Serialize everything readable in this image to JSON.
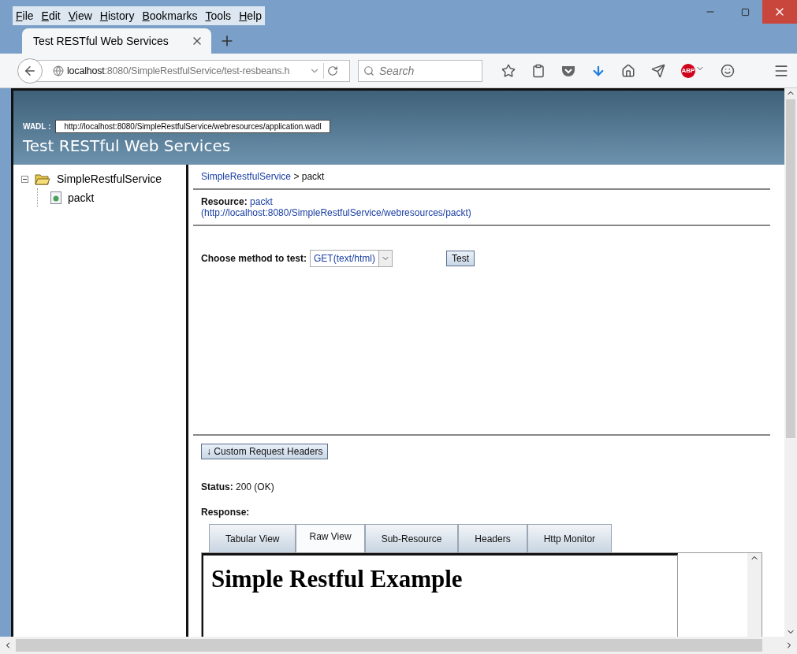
{
  "menu": [
    "File",
    "Edit",
    "View",
    "History",
    "Bookmarks",
    "Tools",
    "Help"
  ],
  "browser_tabs": [
    {
      "title": "Test RESTful Web Services",
      "selected": true
    }
  ],
  "address": {
    "host": "localhost",
    "path": ":8080/SimpleRestfulService/test-resbeans.h"
  },
  "search": {
    "placeholder": "Search"
  },
  "adblock_badge": "ABP",
  "header": {
    "wadl_label": "WADL :",
    "wadl_url": "http://localhost:8080/SimpleRestfulService/webresources/application.wadl",
    "title": "Test RESTful Web Services"
  },
  "tree": [
    {
      "label": "SimpleRestfulService",
      "expanded": true,
      "children": [
        {
          "label": "packt"
        }
      ]
    }
  ],
  "breadcrumb": {
    "link": "SimpleRestfulService",
    "current": "> packt"
  },
  "resource": {
    "label": "Resource:",
    "name": "packt",
    "url": "(http://localhost:8080/SimpleRestfulService/webresources/packt)"
  },
  "method": {
    "label": "Choose method to test:",
    "value": "GET(text/html)",
    "button": "Test"
  },
  "headers_button": "↓ Custom Request Headers",
  "status": {
    "label": "Status:",
    "value": "200 (OK)"
  },
  "response": {
    "label": "Response:",
    "tabs": [
      {
        "label": "Tabular View",
        "selected": false
      },
      {
        "label": "Raw View",
        "selected": true
      },
      {
        "label": "Sub-Resource",
        "selected": false
      },
      {
        "label": "Headers",
        "selected": false
      },
      {
        "label": "Http Monitor",
        "selected": false
      }
    ],
    "content": "Simple Restful Example"
  }
}
